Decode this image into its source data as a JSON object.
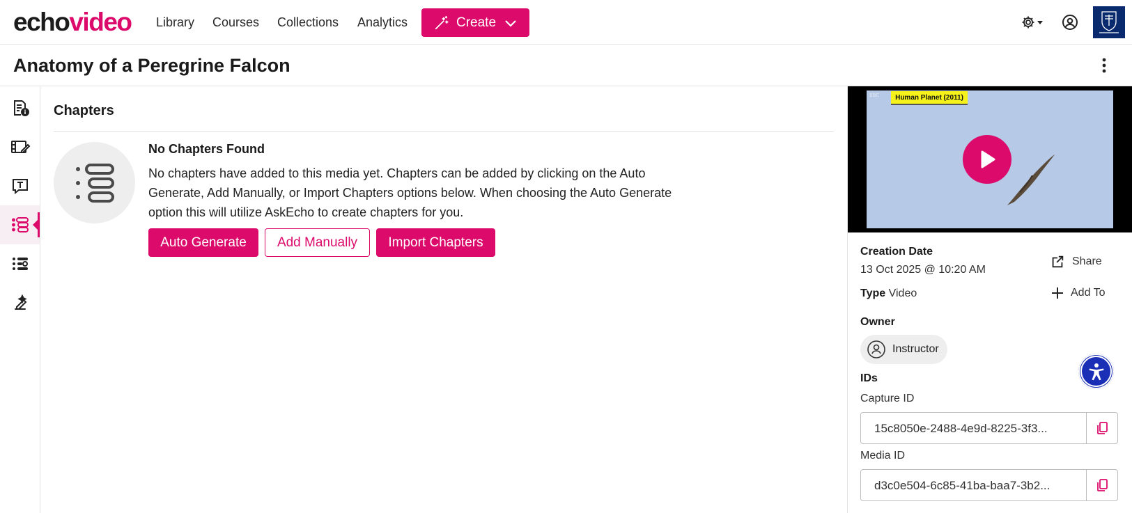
{
  "app": {
    "logo_part1": "echo",
    "logo_part2": "video",
    "brand_color": "#dc0a6b"
  },
  "nav": {
    "items": [
      {
        "label": "Library"
      },
      {
        "label": "Courses"
      },
      {
        "label": "Collections"
      },
      {
        "label": "Analytics"
      }
    ],
    "create_label": "Create",
    "icons": [
      "settings-icon",
      "user-account-icon",
      "university-logo"
    ]
  },
  "page": {
    "title": "Anatomy of a Peregrine Falcon"
  },
  "rail": {
    "items": [
      {
        "icon": "details-icon"
      },
      {
        "icon": "video-edit-icon"
      },
      {
        "icon": "transcript-icon"
      },
      {
        "icon": "chapters-icon",
        "active": true
      },
      {
        "icon": "quiz-list-icon"
      },
      {
        "icon": "annotate-icon"
      }
    ]
  },
  "chapters": {
    "section_title": "Chapters",
    "empty_heading": "No Chapters Found",
    "empty_text": "No chapters have added to this media yet. Chapters can be added by clicking on the Auto Generate, Add Manually, or Import Chapters options below. When choosing the Auto Generate option this will utilize AskEcho to create chapters for you.",
    "buttons": {
      "auto_generate": "Auto Generate",
      "add_manually": "Add Manually",
      "import_chapters": "Import Chapters"
    }
  },
  "media": {
    "video_caption": "Human Planet (2011)",
    "creation_date_label": "Creation Date",
    "creation_date": "13 Oct 2025 @ 10:20 AM",
    "type_label": "Type",
    "type_value": "Video",
    "share_label": "Share",
    "add_to_label": "Add To",
    "owner_label": "Owner",
    "owner_name": "Instructor",
    "ids_label": "IDs",
    "capture_id_label": "Capture ID",
    "capture_id": "15c8050e-2488-4e9d-8225-3f3...",
    "media_id_label": "Media ID",
    "media_id": "d3c0e504-6c85-41ba-baa7-3b2..."
  }
}
